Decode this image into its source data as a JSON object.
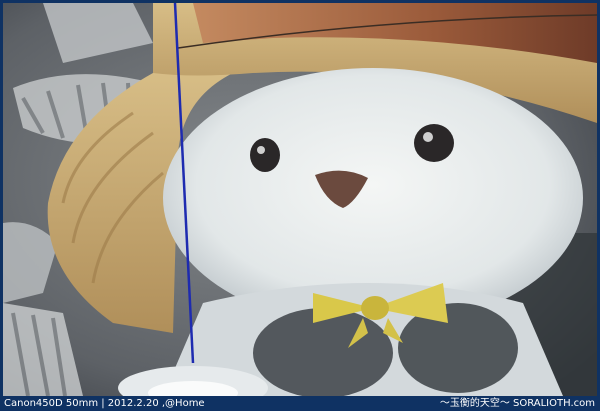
{
  "caption": {
    "left": "Canon450D 50mm | 2012.2.20 ,@Home",
    "right": "～玉衡的天空～ SORALIOTH.com"
  },
  "colors": {
    "frame": "#0f3263",
    "background": "#6b6f73",
    "hat_straw": "#c7a870",
    "hat_band": "#9e5d3c",
    "bear_fur": "#e8ecec",
    "bow": "#d9c84a",
    "nose": "#6b4a3e"
  },
  "image": {
    "subject": "white-teddy-bear-with-straw-hat"
  }
}
